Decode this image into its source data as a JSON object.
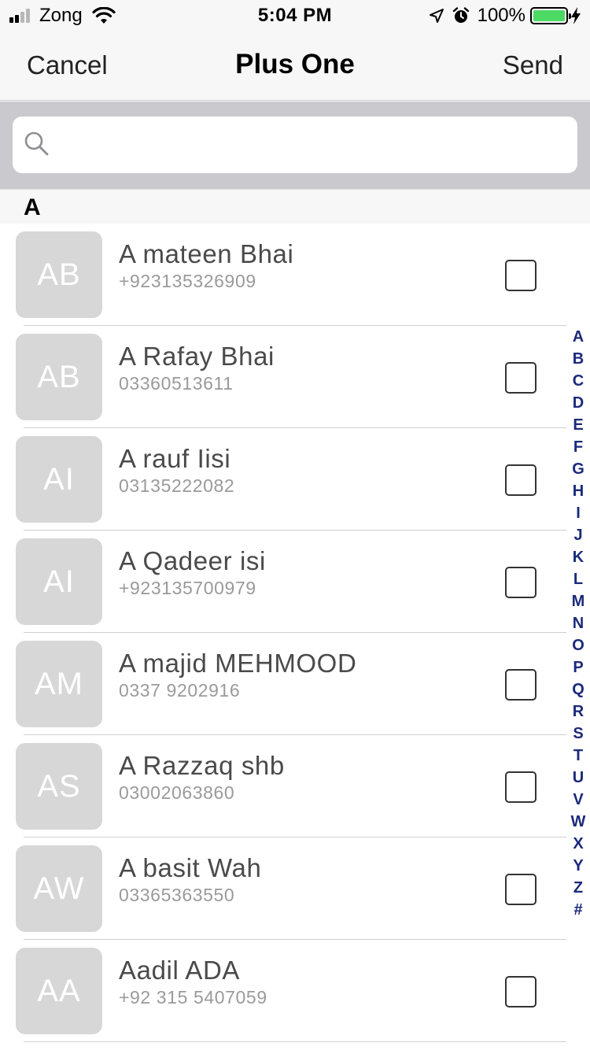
{
  "status_bar": {
    "carrier": "Zong",
    "time": "5:04 PM",
    "battery_percent": "100%",
    "battery_level": 1.0,
    "signal_bars_filled": 2,
    "signal_bars_total": 4,
    "icons": [
      "signal-icon",
      "wifi-icon",
      "location-arrow-icon",
      "alarm-icon",
      "battery-icon",
      "charging-bolt-icon"
    ]
  },
  "nav": {
    "cancel_label": "Cancel",
    "title": "Plus One",
    "send_label": "Send"
  },
  "search": {
    "placeholder": "",
    "value": ""
  },
  "section": {
    "header": "A"
  },
  "contacts": [
    {
      "initials": "AB",
      "name": "A mateen Bhai",
      "phone": "+923135326909",
      "checked": false
    },
    {
      "initials": "AB",
      "name": "A Rafay Bhai",
      "phone": "03360513611",
      "checked": false
    },
    {
      "initials": "AI",
      "name": "A rauf Iisi",
      "phone": "03135222082",
      "checked": false
    },
    {
      "initials": "AI",
      "name": "A Qadeer isi",
      "phone": "+923135700979",
      "checked": false
    },
    {
      "initials": "AM",
      "name": "A majid MEHMOOD",
      "phone": "0337 9202916",
      "checked": false
    },
    {
      "initials": "AS",
      "name": "A Razzaq shb",
      "phone": "03002063860",
      "checked": false
    },
    {
      "initials": "AW",
      "name": "A basit Wah",
      "phone": "03365363550",
      "checked": false
    },
    {
      "initials": "AA",
      "name": "Aadil ADA",
      "phone": "+92 315 5407059",
      "checked": false
    }
  ],
  "alphabet_index": [
    "A",
    "B",
    "C",
    "D",
    "E",
    "F",
    "G",
    "H",
    "I",
    "J",
    "K",
    "L",
    "M",
    "N",
    "O",
    "P",
    "Q",
    "R",
    "S",
    "T",
    "U",
    "V",
    "W",
    "X",
    "Y",
    "Z",
    "#"
  ],
  "colors": {
    "bar_background": "#f7f7f7",
    "search_background": "#c9c9ce",
    "avatar_background": "#d7d7d7",
    "index_letter": "#1b2a7a",
    "battery_fill": "#4cd964"
  }
}
